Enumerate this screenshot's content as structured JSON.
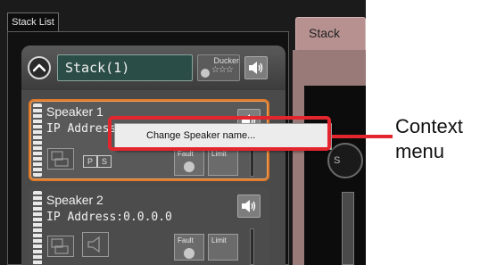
{
  "left_panel": {
    "tab_label": "Stack List",
    "stack": {
      "name": "Stack(1)",
      "ducker_label": "Ducker",
      "ducker_stars": "☆☆☆"
    },
    "speakers": [
      {
        "name": "Speaker 1",
        "ip_label": "IP Address",
        "badges": [
          "P",
          "S"
        ],
        "fault_label": "Fault",
        "limit_label": "Limit",
        "selected": true
      },
      {
        "name": "Speaker 2",
        "ip_label": "IP Address:0.0.0.0",
        "fault_label": "Fault",
        "limit_label": "Limit",
        "selected": false
      }
    ]
  },
  "context_menu": {
    "items": [
      "Change Speaker name..."
    ]
  },
  "right_panel": {
    "tab_label": "Stack",
    "circle_label": "S"
  },
  "annotation": {
    "line1": "Context",
    "line2": "menu"
  },
  "colors": {
    "selection_border": "#e07a28",
    "callout_red": "#e3262d",
    "stack_name_bg": "#2b4d47",
    "right_panel": "#b69190"
  },
  "icons": [
    "chevron-up-icon",
    "speaker-volume-icon",
    "speaker-chain-icon",
    "monitor-icon",
    "speaker-thumbnail-icon"
  ]
}
